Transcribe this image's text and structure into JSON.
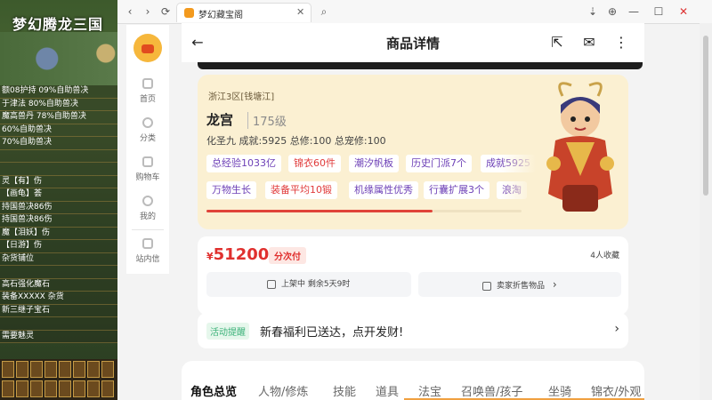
{
  "game": {
    "title": "梦幻腾龙三国",
    "lines": [
      "额08护持 09%自助兽决",
      "于津法 80%自助兽决",
      "魔高兽丹 78%自助兽决",
      "60%自助兽决",
      "70%自助兽决",
      "",
      "",
      "灵【有】伤",
      "【画龟】荟",
      "持国兽决86伤",
      "持国兽决86伤",
      "魔【泪妖】伤",
      "【日游】伤",
      "杂货铺位",
      "",
      "高石强化魔石",
      "装备XXXXX 杂货",
      "新三继子宝石",
      "",
      "需要魅灵"
    ]
  },
  "browser": {
    "tab_title": "梦幻藏宝阁",
    "nav": {
      "back": "‹",
      "forward": "›",
      "refresh": "⟳",
      "search": "⌕"
    },
    "window": {
      "download": "⇣",
      "globe": "⊕",
      "minimize": "—",
      "maximize": "☐",
      "close": "✕"
    }
  },
  "sidebar": {
    "items": [
      {
        "label": "首页"
      },
      {
        "label": "分类"
      },
      {
        "label": "购物车"
      },
      {
        "label": "我的"
      },
      {
        "label": "站内信"
      }
    ]
  },
  "header": {
    "title": "商品详情",
    "back": "←",
    "share": "⇱",
    "mail": "✉",
    "more": "⋮"
  },
  "character": {
    "server": "浙江3区[钱塘江]",
    "role": "龙宫",
    "level": "175级",
    "stats": "化圣九 成就:5925 总修:100 总宠修:100",
    "tags_row1": [
      {
        "text": "总经验1033亿",
        "color": "purple"
      },
      {
        "text": "锦衣60件",
        "color": "red"
      },
      {
        "text": "潮汐帆板",
        "color": "purple"
      },
      {
        "text": "历史门派7个",
        "color": "purple"
      },
      {
        "text": "成就5925",
        "color": "purple"
      }
    ],
    "tags_row2": [
      {
        "text": "万物生长",
        "color": "purple"
      },
      {
        "text": "装备平均10锻",
        "color": "red"
      },
      {
        "text": "机缘属性优秀",
        "color": "purple"
      },
      {
        "text": "行囊扩展3个",
        "color": "purple"
      },
      {
        "text": "浪淘",
        "color": "purple"
      }
    ]
  },
  "price": {
    "currency": "¥",
    "amount": "51200",
    "installment": "分次付",
    "favorites": "4人收藏",
    "listing": "上架中 剩余5天9时",
    "seller": "卖家折售物品",
    "seller_arrow": "›"
  },
  "activity": {
    "badge": "活动提醒",
    "text": "新春福利已送达，点开发财!",
    "arrow": "›"
  },
  "tabs": [
    "角色总览",
    "人物/修炼",
    "技能",
    "道具",
    "法宝",
    "召唤兽/孩子",
    "坐骑",
    "锦衣/外观"
  ]
}
